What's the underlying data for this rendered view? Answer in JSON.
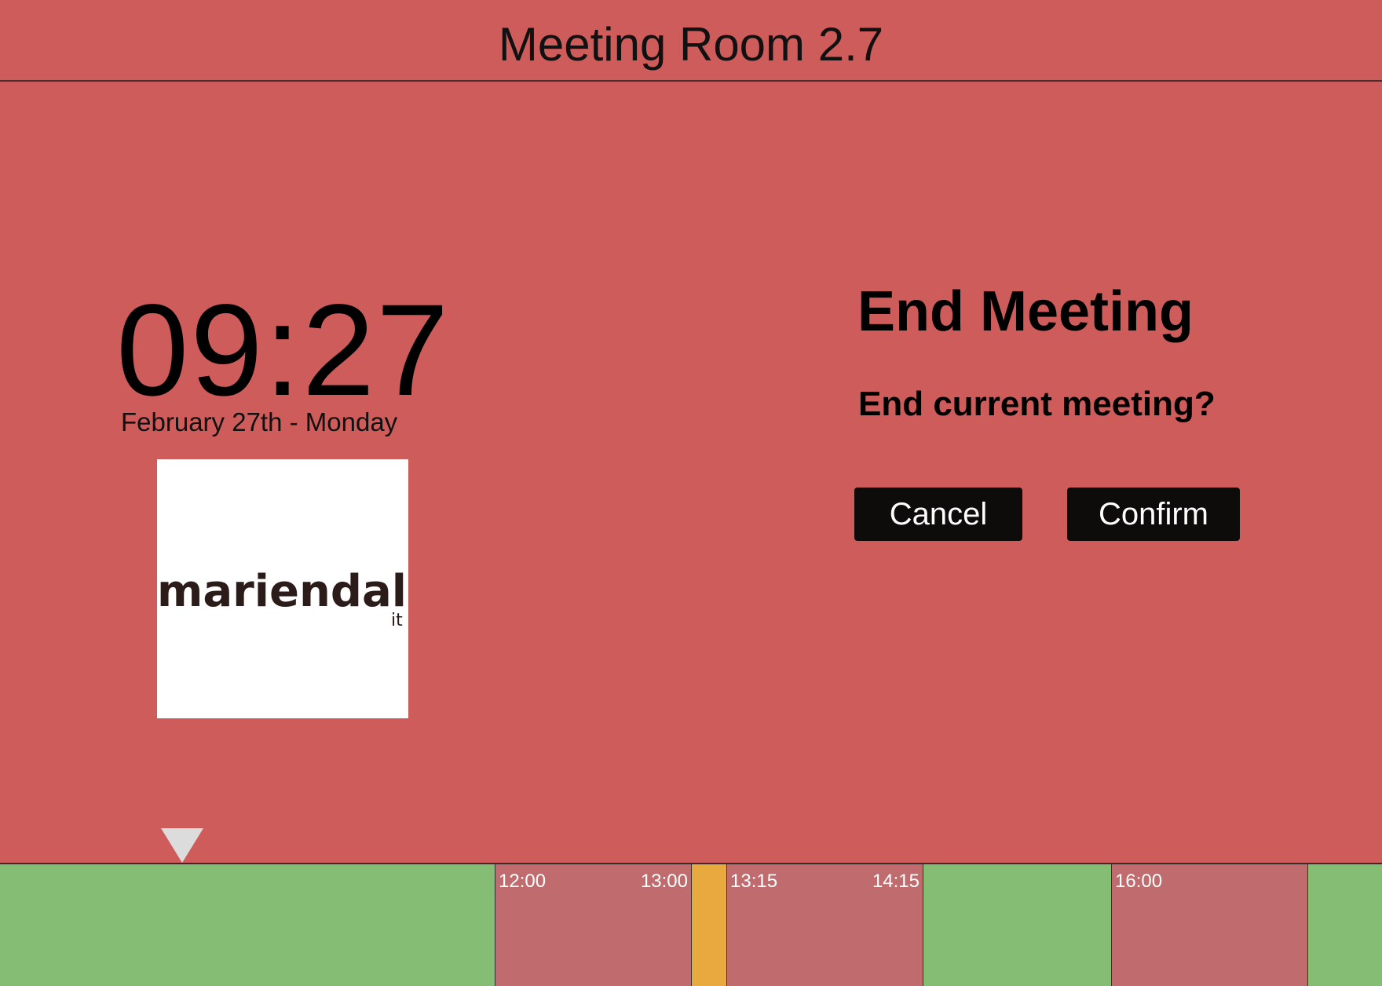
{
  "header": {
    "title": "Meeting Room 2.7"
  },
  "clock": {
    "time": "09:27",
    "date": "February 27th - Monday"
  },
  "logo": {
    "text": "mariendal",
    "subtext": "it",
    "accent_color": "#e8843a"
  },
  "dialog": {
    "title": "End Meeting",
    "message": "End current meeting?",
    "cancel_label": "Cancel",
    "confirm_label": "Confirm"
  },
  "colors": {
    "background": "#cd5c5a",
    "free": "#84bd73",
    "busy": "#c06c6e",
    "current": "#e8a93e",
    "button": "#0e0b0b"
  },
  "timeline": {
    "marker_icon": "triangle-down-icon",
    "segments": [
      {
        "status": "free",
        "start_label": "",
        "end_label": ""
      },
      {
        "status": "busy",
        "start_label": "12:00",
        "end_label": "13:00"
      },
      {
        "status": "current",
        "start_label": "",
        "end_label": ""
      },
      {
        "status": "busy",
        "start_label": "13:15",
        "end_label": "14:15"
      },
      {
        "status": "free",
        "start_label": "",
        "end_label": ""
      },
      {
        "status": "busy",
        "start_label": "16:00",
        "end_label": ""
      },
      {
        "status": "free",
        "start_label": "",
        "end_label": ""
      }
    ]
  }
}
